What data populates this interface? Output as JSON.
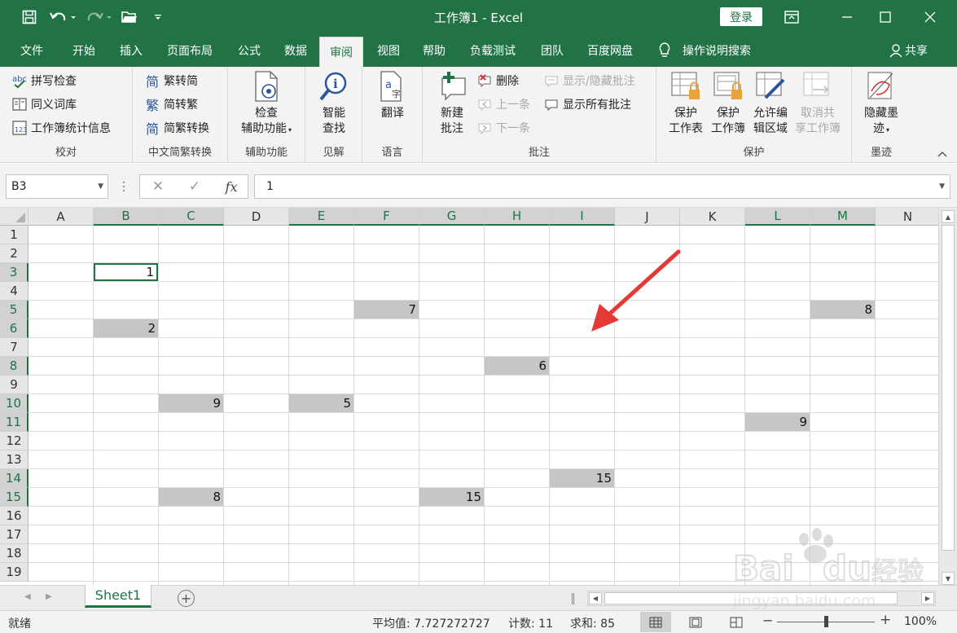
{
  "window": {
    "title": "工作簿1 - Excel",
    "login_label": "登录"
  },
  "tabs": [
    "文件",
    "开始",
    "插入",
    "页面布局",
    "公式",
    "数据",
    "审阅",
    "视图",
    "帮助",
    "负载测试",
    "团队",
    "百度网盘"
  ],
  "active_tab": "审阅",
  "tell_me": "操作说明搜索",
  "share": "共享",
  "ribbon": {
    "proofing": {
      "label": "校对",
      "spell": "拼写检查",
      "thesaurus": "同义词库",
      "stats": "工作簿统计信息"
    },
    "chinese": {
      "label": "中文简繁转换",
      "to_simplified": "繁转简",
      "to_traditional": "简转繁",
      "convert": "简繁转换"
    },
    "accessibility": {
      "label": "辅助功能",
      "check_line1": "检查",
      "check_line2": "辅助功能"
    },
    "insights": {
      "label": "见解",
      "smart_line1": "智能",
      "smart_line2": "查找"
    },
    "language": {
      "label": "语言",
      "translate": "翻译"
    },
    "comments": {
      "label": "批注",
      "new_line1": "新建",
      "new_line2": "批注",
      "delete": "删除",
      "prev": "上一条",
      "next": "下一条",
      "show_hide": "显示/隐藏批注",
      "show_all": "显示所有批注"
    },
    "protect": {
      "label": "保护",
      "sheet_line1": "保护",
      "sheet_line2": "工作表",
      "book_line1": "保护",
      "book_line2": "工作簿",
      "edit_line1": "允许编",
      "edit_line2": "辑区域",
      "unshare_line1": "取消共",
      "unshare_line2": "享工作簿"
    },
    "ink": {
      "label": "墨迹",
      "hide_line1": "隐藏墨",
      "hide_line2": "迹"
    }
  },
  "formula_bar": {
    "name_box": "B3",
    "fx": "fx",
    "value": "1"
  },
  "grid": {
    "columns": [
      "A",
      "B",
      "C",
      "D",
      "E",
      "F",
      "G",
      "H",
      "I",
      "J",
      "K",
      "L",
      "M",
      "N"
    ],
    "selected_columns": [
      "B",
      "C",
      "E",
      "F",
      "G",
      "H",
      "I",
      "L",
      "M"
    ],
    "rows": [
      "1",
      "2",
      "3",
      "4",
      "5",
      "6",
      "7",
      "8",
      "9",
      "10",
      "11",
      "12",
      "13",
      "14",
      "15",
      "16",
      "17",
      "18",
      "19"
    ],
    "selected_rows": [
      "3",
      "5",
      "6",
      "8",
      "10",
      "11",
      "14",
      "15"
    ],
    "active_cell": "B3",
    "cells": [
      {
        "ref": "B3",
        "value": "1"
      },
      {
        "ref": "F5",
        "value": "7"
      },
      {
        "ref": "M5",
        "value": "8"
      },
      {
        "ref": "B6",
        "value": "2"
      },
      {
        "ref": "H8",
        "value": "6"
      },
      {
        "ref": "C10",
        "value": "9"
      },
      {
        "ref": "E10",
        "value": "5"
      },
      {
        "ref": "L11",
        "value": "9"
      },
      {
        "ref": "I14",
        "value": "15"
      },
      {
        "ref": "C15",
        "value": "8"
      },
      {
        "ref": "G15",
        "value": "15"
      }
    ]
  },
  "sheets": [
    "Sheet1"
  ],
  "status": {
    "ready": "就绪",
    "average": "平均值: 7.727272727",
    "count": "计数: 11",
    "sum": "求和: 85",
    "zoom": "100%"
  },
  "colors": {
    "brand": "#217346",
    "selection_fill": "#c6c6c6",
    "arrow": "#e53935"
  }
}
